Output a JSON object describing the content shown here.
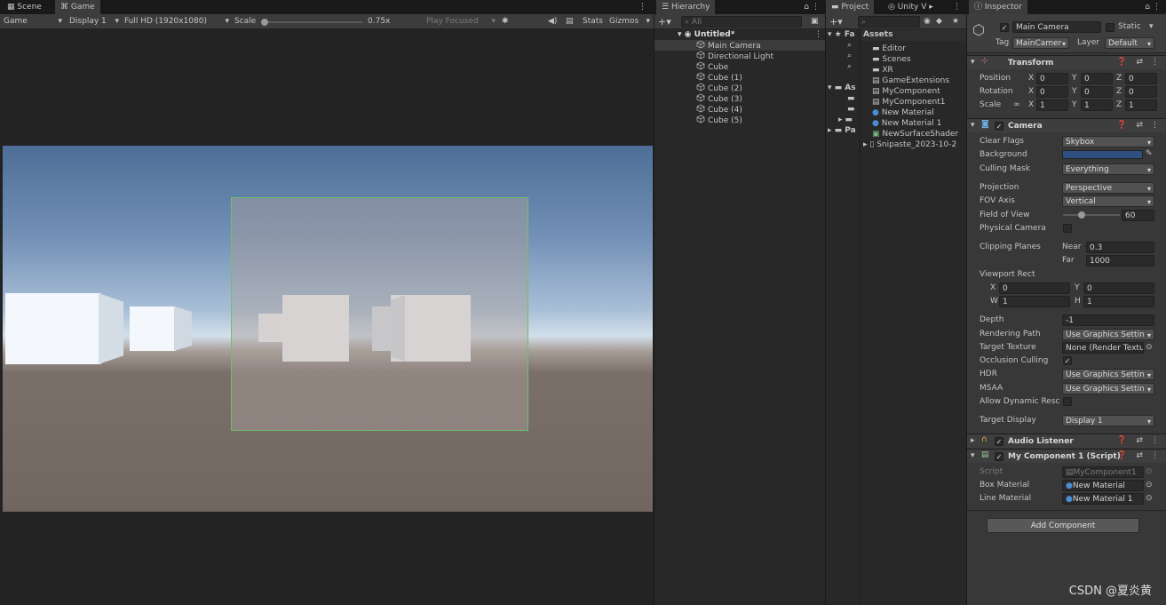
{
  "scene_panel": {
    "tabs": [
      "Scene",
      "Game"
    ],
    "toolbar": {
      "mode": "Game",
      "display": "Display 1",
      "resolution": "Full HD (1920x1080)",
      "scale_label": "Scale",
      "scale_value": "0.75x",
      "play_focused": "Play Focused",
      "stats": "Stats",
      "gizmos": "Gizmos"
    }
  },
  "hierarchy": {
    "tab": "Hierarchy",
    "search_placeholder": "All",
    "scene": "Untitled*",
    "items": [
      "Main Camera",
      "Directional Light",
      "Cube",
      "Cube (1)",
      "Cube (2)",
      "Cube (3)",
      "Cube (4)",
      "Cube (5)"
    ]
  },
  "project": {
    "tabs": [
      "Project",
      "Unity V"
    ],
    "favorites_short": "Fa",
    "assets_short": "As",
    "packages_short": "Pa",
    "assets_header": "Assets",
    "items": [
      "Editor",
      "Scenes",
      "XR",
      "GameExtensions",
      "MyComponent",
      "MyComponent1",
      "New Material",
      "New Material 1",
      "NewSurfaceShader",
      "Snipaste_2023-10-2"
    ]
  },
  "inspector": {
    "tab": "Inspector",
    "object_name": "Main Camera",
    "static_label": "Static",
    "tag_label": "Tag",
    "tag_value": "MainCamer",
    "layer_label": "Layer",
    "layer_value": "Default",
    "transform": {
      "title": "Transform",
      "position_label": "Position",
      "rotation_label": "Rotation",
      "scale_label": "Scale",
      "position": [
        "0",
        "0",
        "0"
      ],
      "rotation": [
        "0",
        "0",
        "0"
      ],
      "scale": [
        "1",
        "1",
        "1"
      ],
      "axis_x": "X",
      "axis_y": "Y",
      "axis_z": "Z"
    },
    "camera": {
      "title": "Camera",
      "clear_flags_label": "Clear Flags",
      "clear_flags": "Skybox",
      "background_label": "Background",
      "background_color": "#2f4f7f",
      "culling_mask_label": "Culling Mask",
      "culling_mask": "Everything",
      "projection_label": "Projection",
      "projection": "Perspective",
      "fov_axis_label": "FOV Axis",
      "fov_axis": "Vertical",
      "fov_label": "Field of View",
      "fov": "60",
      "fov_fraction": 0.33,
      "physical_label": "Physical Camera",
      "clipping_label": "Clipping Planes",
      "near_label": "Near",
      "near": "0.3",
      "far_label": "Far",
      "far": "1000",
      "viewport_label": "Viewport Rect",
      "vx_label": "X",
      "vx": "0",
      "vy_label": "Y",
      "vy": "0",
      "vw_label": "W",
      "vw": "1",
      "vh_label": "H",
      "vh": "1",
      "depth_label": "Depth",
      "depth": "-1",
      "rendering_path_label": "Rendering Path",
      "rendering_path": "Use Graphics Settin",
      "target_texture_label": "Target Texture",
      "target_texture": "None (Render Textu",
      "occlusion_label": "Occlusion Culling",
      "hdr_label": "HDR",
      "hdr": "Use Graphics Settin",
      "msaa_label": "MSAA",
      "msaa": "Use Graphics Settin",
      "dynamic_label": "Allow Dynamic Resc",
      "target_display_label": "Target Display",
      "target_display": "Display 1"
    },
    "audio_listener": {
      "title": "Audio Listener"
    },
    "my_component": {
      "title": "My Component 1 (Script)",
      "script_label": "Script",
      "script": "MyComponent1",
      "box_material_label": "Box Material",
      "box_material": "New Material",
      "line_material_label": "Line Material",
      "line_material": "New Material 1"
    },
    "add_component": "Add Component"
  },
  "watermark": "CSDN @夏炎黄"
}
